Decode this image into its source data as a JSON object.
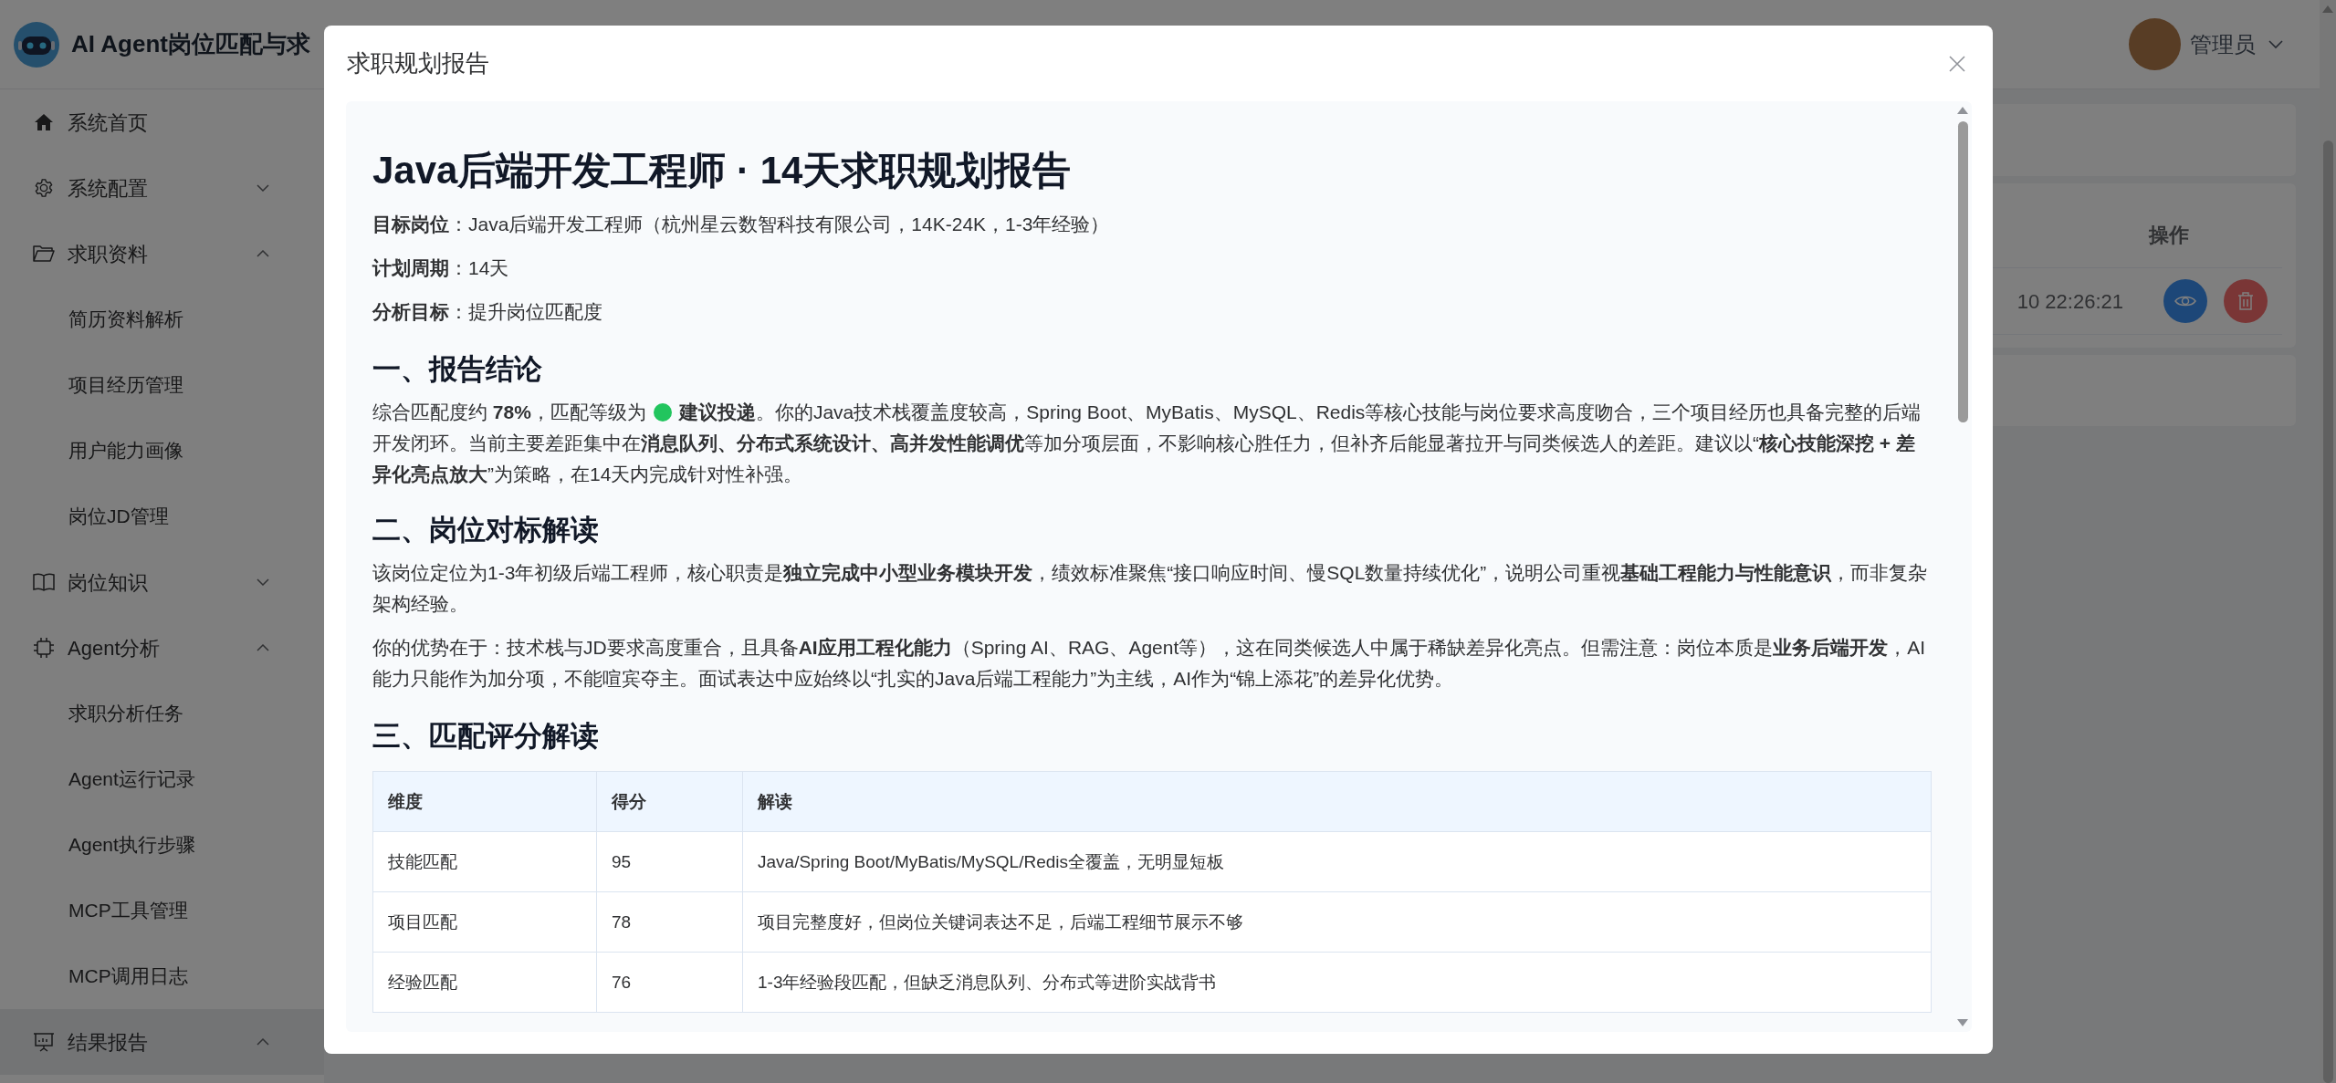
{
  "header": {
    "app_title": "AI Agent岗位匹配与求",
    "user": {
      "name": "管理员"
    }
  },
  "sidebar": {
    "items": [
      {
        "kind": "link",
        "label": "系统首页",
        "selected": false
      },
      {
        "kind": "group",
        "label": "系统配置",
        "expanded": false,
        "selected": false
      },
      {
        "kind": "group",
        "label": "求职资料",
        "expanded": true,
        "selected": false,
        "children": [
          {
            "label": "简历资料解析",
            "selected": false
          },
          {
            "label": "项目经历管理",
            "selected": false
          },
          {
            "label": "用户能力画像",
            "selected": false
          },
          {
            "label": "岗位JD管理",
            "selected": false
          }
        ]
      },
      {
        "kind": "group",
        "label": "岗位知识",
        "expanded": false,
        "selected": false
      },
      {
        "kind": "group",
        "label": "Agent分析",
        "expanded": true,
        "selected": false,
        "children": [
          {
            "label": "求职分析任务",
            "selected": false
          },
          {
            "label": "Agent运行记录",
            "selected": false
          },
          {
            "label": "Agent执行步骤",
            "selected": false
          },
          {
            "label": "MCP工具管理",
            "selected": false
          },
          {
            "label": "MCP调用日志",
            "selected": false
          }
        ]
      },
      {
        "kind": "group",
        "label": "结果报告",
        "expanded": true,
        "selected": true
      }
    ]
  },
  "background_table": {
    "action_header": "操作",
    "rows": [
      {
        "time": "10 22:26:21"
      }
    ]
  },
  "modal": {
    "title": "求职规划报告",
    "report": {
      "title": "Java后端开发工程师 · 14天求职规划报告",
      "meta": [
        "**目标岗位**：Java后端开发工程师（杭州星云数智科技有限公司，14K-24K，1-3年经验）",
        "**计划周期**：14天",
        "**分析目标**：提升岗位匹配度"
      ],
      "sections": [
        {
          "heading": "一、报告结论",
          "conclusion": {
            "before": "综合匹配度约 **78%**，匹配等级为",
            "color": "#22c55e",
            "after": "**建议投递**。你的Java技术栈覆盖度较高，Spring Boot、MyBatis、MySQL、Redis等核心技能与岗位要求高度吻合，三个项目经历也具备完整的后端开发闭环。当前主要差距集中在**消息队列、分布式系统设计、高并发性能调优**等加分项层面，不影响核心胜任力，但补齐后能显著拉开与同类候选人的差距。建议以“**核心技能深挖 + 差异化亮点放大**”为策略，在14天内完成针对性补强。"
          }
        },
        {
          "heading": "二、岗位对标解读",
          "paragraphs": [
            "该岗位定位为1-3年初级后端工程师，核心职责是**独立完成中小型业务模块开发**，绩效标准聚焦“接口响应时间、慢SQL数量持续优化”，说明公司重视**基础工程能力与性能意识**，而非复杂架构经验。",
            "你的优势在于：技术栈与JD要求高度重合，且具备**AI应用工程化能力**（Spring AI、RAG、Agent等），这在同类候选人中属于稀缺差异化亮点。但需注意：岗位本质是**业务后端开发**，AI能力只能作为加分项，不能喧宾夺主。面试表达中应始终以“扎实的Java后端工程能力”为主线，AI作为“锦上添花”的差异化优势。"
          ]
        },
        {
          "heading": "三、匹配评分解读",
          "table": {
            "columns": [
              "维度",
              "得分",
              "解读"
            ],
            "rows": [
              [
                "技能匹配",
                "95",
                "Java/Spring Boot/MyBatis/MySQL/Redis全覆盖，无明显短板"
              ],
              [
                "项目匹配",
                "78",
                "项目完整度好，但岗位关键词表达不足，后端工程细节展示不够"
              ],
              [
                "经验匹配",
                "76",
                "1-3年经验段匹配，但缺乏消息队列、分布式等进阶实战背书"
              ]
            ]
          }
        }
      ]
    }
  }
}
